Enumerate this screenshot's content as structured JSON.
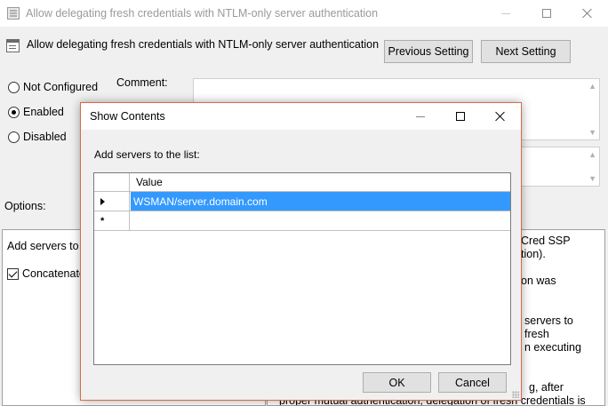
{
  "outer_window": {
    "title": "Allow delegating fresh credentials with NTLM-only server authentication",
    "policy_title": "Allow delegating fresh credentials with NTLM-only server authentication",
    "previous_setting": "Previous Setting",
    "next_setting": "Next Setting",
    "radio_options": [
      {
        "label": "Not Configured",
        "checked": false
      },
      {
        "label": "Enabled",
        "checked": true
      },
      {
        "label": "Disabled",
        "checked": false
      }
    ],
    "comment_label": "Comment:",
    "options_label": "Options:",
    "options_panel": {
      "add_servers_text": "Add servers to t",
      "concatenate_label": "Concatenate",
      "concatenate_checked": true
    },
    "help_lines": [
      "Cred SSP",
      "tion).",
      "on was",
      "servers to",
      "fresh",
      "n executing",
      "g, after",
      "proper mutual authentication, delegation of fresh credentials is"
    ]
  },
  "dialog": {
    "title": "Show Contents",
    "instruction": "Add servers to the list:",
    "column_header": "Value",
    "rows": [
      {
        "value": "WSMAN/server.domain.com",
        "selected": true
      },
      {
        "value": "",
        "selected": false
      }
    ],
    "ok_label": "OK",
    "cancel_label": "Cancel"
  }
}
